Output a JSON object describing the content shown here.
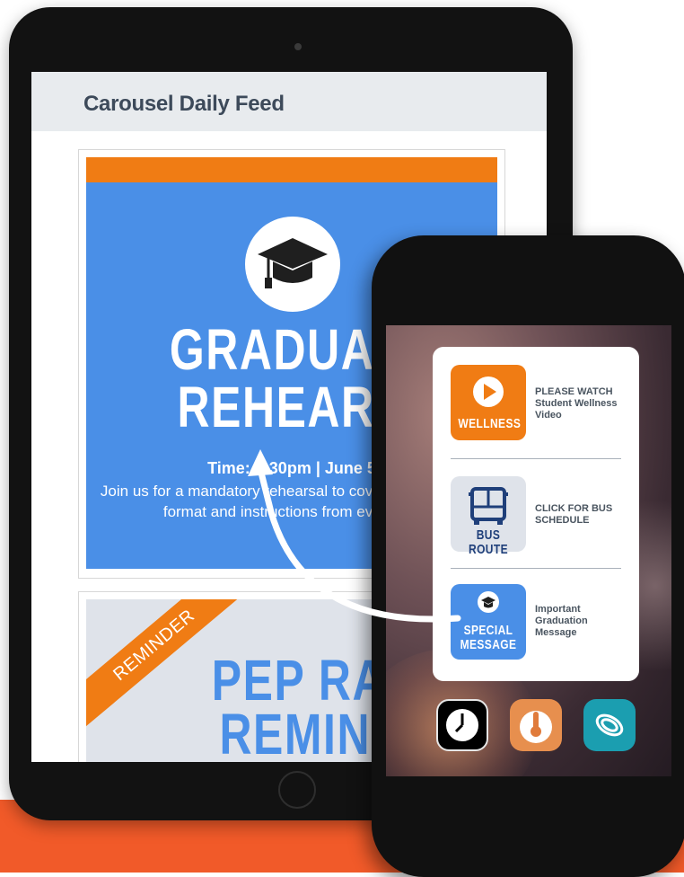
{
  "feed": {
    "title": "Carousel Daily Feed",
    "card1": {
      "headline_line1": "GRADUATI",
      "headline_line2": "REHEARS",
      "time": "Time: 3:30pm | June 5",
      "body": "Join us for a mandatory rehearsal to cover the ceremony format and instructions from event org"
    },
    "card2": {
      "ribbon": "REMINDER",
      "headline_line1": "PEP RALL",
      "headline_line2": "REMINDE"
    }
  },
  "phone": {
    "widget": {
      "items": [
        {
          "icon_caption": "WELLNESS",
          "label_caps": "PLEASE WATCH",
          "label": "Student Wellness Video"
        },
        {
          "icon_caption": "BUS ROUTE",
          "label_caps": "CLICK FOR BUS SCHEDULE",
          "label": ""
        },
        {
          "icon_caption_1": "SPECIAL",
          "icon_caption_2": "MESSAGE",
          "label": "Important Graduation Message"
        }
      ]
    },
    "dock": [
      "clock-icon",
      "thermometer-icon",
      "swirl-icon"
    ]
  },
  "colors": {
    "accent_orange": "#f07c14",
    "accent_blue": "#4a8fe7",
    "band_orange": "#f15a29"
  }
}
